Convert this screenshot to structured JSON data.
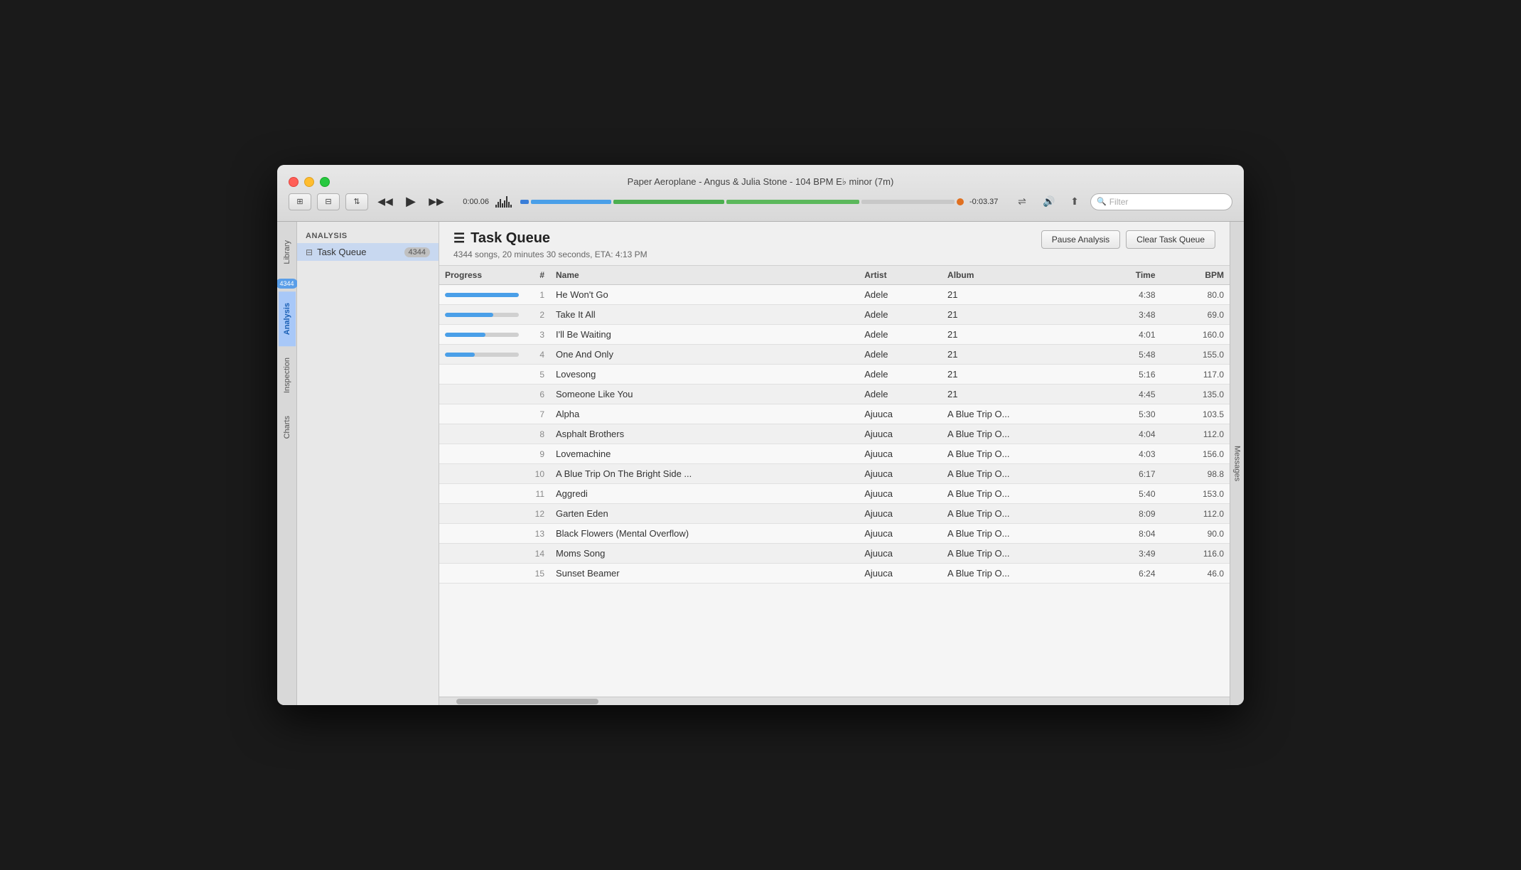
{
  "window": {
    "title": "Paper Aeroplane - Angus & Julia Stone - 104 BPM E♭ minor (7m)"
  },
  "titlebar": {
    "traffic_lights": [
      "red",
      "yellow",
      "green"
    ],
    "time_current": "0:00.06",
    "time_remaining": "-0:03.37",
    "filter_placeholder": "Filter"
  },
  "transport": {
    "rewind_label": "⏮",
    "play_label": "▶",
    "fast_forward_label": "⏭"
  },
  "sidebar": {
    "tabs": [
      {
        "id": "library",
        "label": "Library",
        "active": false
      },
      {
        "id": "analysis",
        "label": "Analysis",
        "active": true,
        "badge": "4344"
      },
      {
        "id": "inspection",
        "label": "Inspection",
        "active": false
      },
      {
        "id": "charts",
        "label": "Charts",
        "active": false
      }
    ],
    "section_title": "ANALYSIS",
    "nav_items": [
      {
        "id": "task-queue",
        "label": "Task Queue",
        "count": "4344",
        "active": true
      }
    ]
  },
  "panel": {
    "title": "Task Queue",
    "subtitle": "4344 songs, 20 minutes 30 seconds, ETA: 4:13 PM",
    "pause_button": "Pause Analysis",
    "clear_button": "Clear Task Queue"
  },
  "table": {
    "columns": [
      {
        "id": "progress",
        "label": "Progress"
      },
      {
        "id": "num",
        "label": "#"
      },
      {
        "id": "name",
        "label": "Name"
      },
      {
        "id": "artist",
        "label": "Artist"
      },
      {
        "id": "album",
        "label": "Album"
      },
      {
        "id": "time",
        "label": "Time"
      },
      {
        "id": "bpm",
        "label": "BPM"
      }
    ],
    "rows": [
      {
        "num": 1,
        "name": "He Won't Go",
        "artist": "Adele",
        "album": "21",
        "time": "4:38",
        "bpm": "80.0",
        "progress": 100,
        "progress_type": "full"
      },
      {
        "num": 2,
        "name": "Take It All",
        "artist": "Adele",
        "album": "21",
        "time": "3:48",
        "bpm": "69.0",
        "progress": 65,
        "progress_type": "partial"
      },
      {
        "num": 3,
        "name": "I'll Be Waiting",
        "artist": "Adele",
        "album": "21",
        "time": "4:01",
        "bpm": "160.0",
        "progress": 55,
        "progress_type": "partial"
      },
      {
        "num": 4,
        "name": "One And Only",
        "artist": "Adele",
        "album": "21",
        "time": "5:48",
        "bpm": "155.0",
        "progress": 40,
        "progress_type": "partial"
      },
      {
        "num": 5,
        "name": "Lovesong",
        "artist": "Adele",
        "album": "21",
        "time": "5:16",
        "bpm": "117.0",
        "progress": 0,
        "progress_type": "none"
      },
      {
        "num": 6,
        "name": "Someone Like You",
        "artist": "Adele",
        "album": "21",
        "time": "4:45",
        "bpm": "135.0",
        "progress": 0,
        "progress_type": "none"
      },
      {
        "num": 7,
        "name": "Alpha",
        "artist": "Ajuuca",
        "album": "A Blue Trip O...",
        "time": "5:30",
        "bpm": "103.5",
        "progress": 0,
        "progress_type": "none"
      },
      {
        "num": 8,
        "name": "Asphalt Brothers",
        "artist": "Ajuuca",
        "album": "A Blue Trip O...",
        "time": "4:04",
        "bpm": "112.0",
        "progress": 0,
        "progress_type": "none"
      },
      {
        "num": 9,
        "name": "Lovemachine",
        "artist": "Ajuuca",
        "album": "A Blue Trip O...",
        "time": "4:03",
        "bpm": "156.0",
        "progress": 0,
        "progress_type": "none"
      },
      {
        "num": 10,
        "name": "A Blue Trip On The Bright Side ...",
        "artist": "Ajuuca",
        "album": "A Blue Trip O...",
        "time": "6:17",
        "bpm": "98.8",
        "progress": 0,
        "progress_type": "none"
      },
      {
        "num": 11,
        "name": "Aggredi",
        "artist": "Ajuuca",
        "album": "A Blue Trip O...",
        "time": "5:40",
        "bpm": "153.0",
        "progress": 0,
        "progress_type": "none"
      },
      {
        "num": 12,
        "name": "Garten Eden",
        "artist": "Ajuuca",
        "album": "A Blue Trip O...",
        "time": "8:09",
        "bpm": "112.0",
        "progress": 0,
        "progress_type": "none"
      },
      {
        "num": 13,
        "name": "Black Flowers (Mental Overflow)",
        "artist": "Ajuuca",
        "album": "A Blue Trip O...",
        "time": "8:04",
        "bpm": "90.0",
        "progress": 0,
        "progress_type": "none"
      },
      {
        "num": 14,
        "name": "Moms Song",
        "artist": "Ajuuca",
        "album": "A Blue Trip O...",
        "time": "3:49",
        "bpm": "116.0",
        "progress": 0,
        "progress_type": "none"
      },
      {
        "num": 15,
        "name": "Sunset Beamer",
        "artist": "Ajuuca",
        "album": "A Blue Trip O...",
        "time": "6:24",
        "bpm": "46.0",
        "progress": 0,
        "progress_type": "none"
      }
    ]
  },
  "messages_tab": {
    "label": "Messages"
  }
}
